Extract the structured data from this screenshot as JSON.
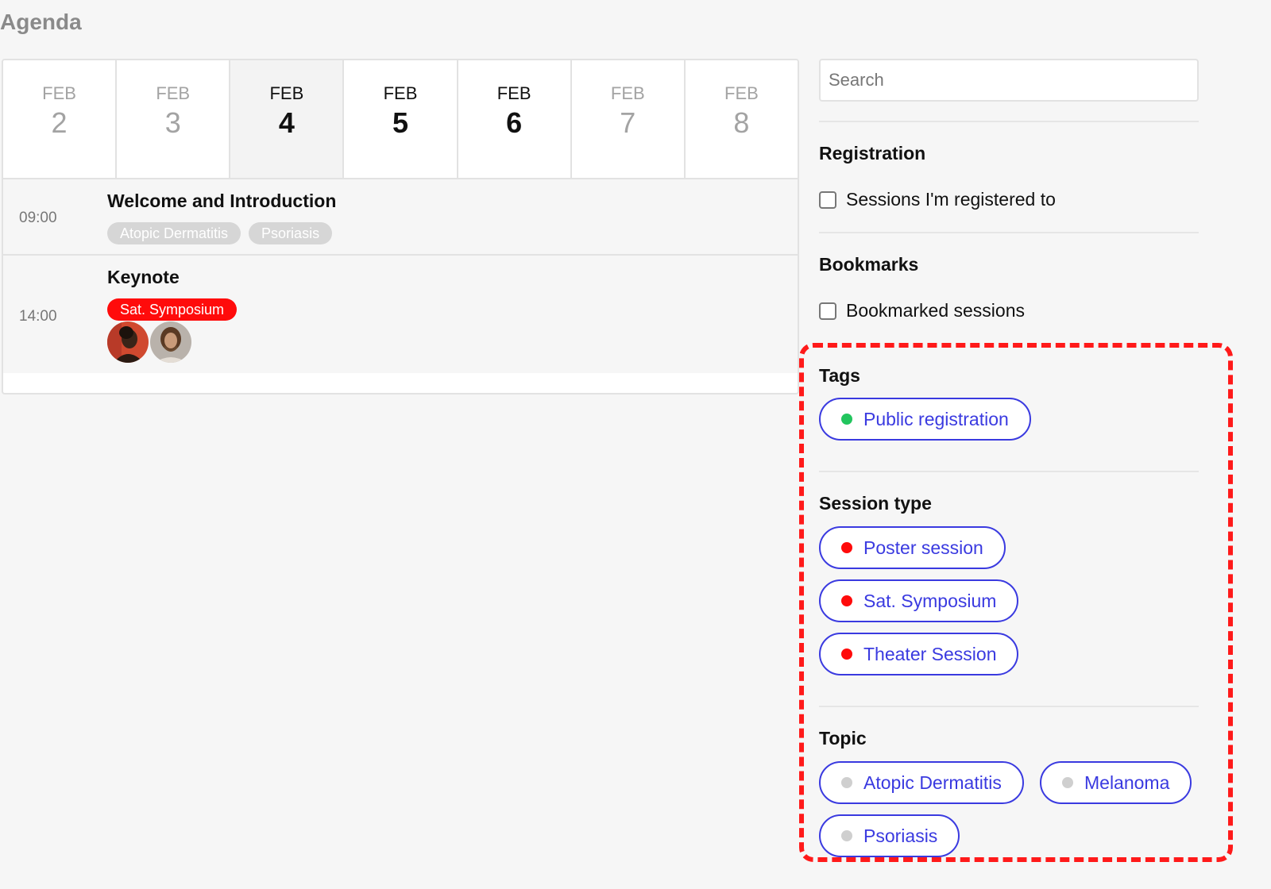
{
  "page": {
    "title": "Agenda"
  },
  "days": [
    {
      "month": "FEB",
      "day": "2",
      "state": "inactive"
    },
    {
      "month": "FEB",
      "day": "3",
      "state": "inactive"
    },
    {
      "month": "FEB",
      "day": "4",
      "state": "selected"
    },
    {
      "month": "FEB",
      "day": "5",
      "state": "active"
    },
    {
      "month": "FEB",
      "day": "6",
      "state": "active"
    },
    {
      "month": "FEB",
      "day": "7",
      "state": "inactive"
    },
    {
      "month": "FEB",
      "day": "8",
      "state": "inactive"
    }
  ],
  "sessions": [
    {
      "time": "09:00",
      "title": "Welcome and Introduction",
      "tags": [
        "Atopic Dermatitis",
        "Psoriasis"
      ]
    },
    {
      "time": "14:00",
      "title": "Keynote",
      "tags": [
        "Sat. Symposium"
      ],
      "speakers": [
        "speaker-1",
        "speaker-2"
      ]
    }
  ],
  "sidebar": {
    "search_placeholder": "Search",
    "registration": {
      "title": "Registration",
      "checkbox_label": "Sessions I'm registered to"
    },
    "bookmarks": {
      "title": "Bookmarks",
      "checkbox_label": "Bookmarked sessions"
    },
    "tags": {
      "title": "Tags",
      "items": [
        {
          "label": "Public registration",
          "dot": "#22c55e"
        }
      ]
    },
    "session_type": {
      "title": "Session type",
      "items": [
        {
          "label": "Poster session",
          "dot": "#ff0b0b"
        },
        {
          "label": "Sat. Symposium",
          "dot": "#ff0b0b"
        },
        {
          "label": "Theater Session",
          "dot": "#ff0b0b"
        }
      ]
    },
    "topic": {
      "title": "Topic",
      "items": [
        {
          "label": "Atopic Dermatitis",
          "dot": "#cfcfcf"
        },
        {
          "label": "Melanoma",
          "dot": "#cfcfcf"
        },
        {
          "label": "Psoriasis",
          "dot": "#cfcfcf"
        }
      ]
    }
  },
  "colors": {
    "accent": "#3a3ae0",
    "highlight_frame": "#ff1a1a",
    "symposium": "#ff0b0b"
  }
}
